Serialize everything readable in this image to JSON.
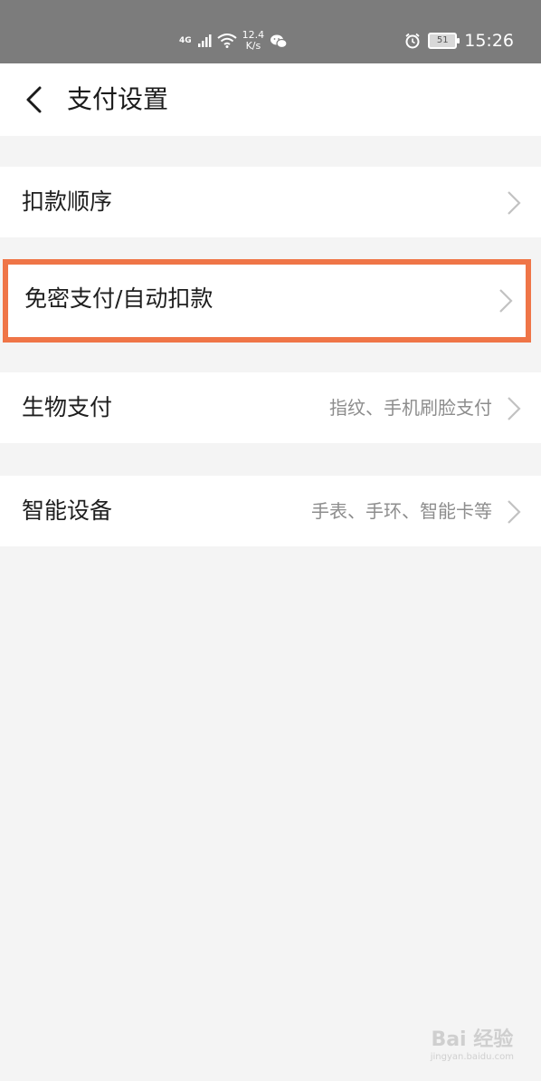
{
  "status_bar": {
    "network": "4G",
    "speed_value": "12.4",
    "speed_unit": "K/s",
    "battery": "51",
    "time": "15:26"
  },
  "header": {
    "title": "支付设置"
  },
  "rows": [
    {
      "label": "扣款顺序",
      "subtitle": ""
    },
    {
      "label": "免密支付/自动扣款",
      "subtitle": ""
    },
    {
      "label": "生物支付",
      "subtitle": "指纹、手机刷脸支付"
    },
    {
      "label": "智能设备",
      "subtitle": "手表、手环、智能卡等"
    }
  ],
  "watermark": {
    "main": "Bai 经验",
    "sub": "jingyan.baidu.com"
  },
  "colors": {
    "status_bar": "#7c7c7c",
    "highlight_border": "#ef7547",
    "background": "#f4f4f4"
  }
}
